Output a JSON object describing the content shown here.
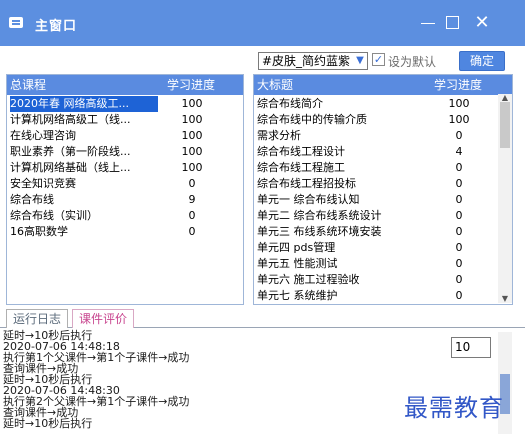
{
  "window": {
    "title": "主窗口"
  },
  "toolbar": {
    "skin_value": "#皮肤_简约蓝紫",
    "set_default_label": "设为默认",
    "set_default_checked": true,
    "confirm_label": "确定",
    "accent_color": "#5c8fe0"
  },
  "courses": {
    "header": {
      "name": "总课程",
      "progress": "学习进度"
    },
    "rows": [
      {
        "name": "2020年春 网络高级工...",
        "progress": "100",
        "selected": true
      },
      {
        "name": "计算机网络高级工（线...",
        "progress": "100"
      },
      {
        "name": "在线心理咨询",
        "progress": "100"
      },
      {
        "name": "职业素养（第一阶段线...",
        "progress": "100"
      },
      {
        "name": "计算机网络基础（线上...",
        "progress": "100"
      },
      {
        "name": "安全知识竞赛",
        "progress": "0"
      },
      {
        "name": "综合布线",
        "progress": "9"
      },
      {
        "name": "综合布线（实训）",
        "progress": "0"
      },
      {
        "name": "16高职数学",
        "progress": "0"
      }
    ]
  },
  "chapters": {
    "header": {
      "name": "大标题",
      "progress": "学习进度"
    },
    "rows": [
      {
        "name": "综合布线简介",
        "progress": "100"
      },
      {
        "name": "综合布线中的传输介质",
        "progress": "100"
      },
      {
        "name": "需求分析",
        "progress": "0"
      },
      {
        "name": "综合布线工程设计",
        "progress": "4"
      },
      {
        "name": "综合布线工程施工",
        "progress": "0"
      },
      {
        "name": "综合布线工程招投标",
        "progress": "0"
      },
      {
        "name": "单元一 综合布线认知",
        "progress": "0"
      },
      {
        "name": "单元二 综合布线系统设计",
        "progress": "0"
      },
      {
        "name": "单元三 布线系统环境安装",
        "progress": "0"
      },
      {
        "name": "单元四 pds管理",
        "progress": "0"
      },
      {
        "name": "单元五 性能测试",
        "progress": "0"
      },
      {
        "name": "单元六 施工过程验收",
        "progress": "0"
      },
      {
        "name": "单元七 系统维护",
        "progress": "0"
      }
    ]
  },
  "tabs": {
    "log": "运行日志",
    "evaluation": "课件评价"
  },
  "log": {
    "lines": [
      "延时→10秒后执行",
      "2020-07-06 14:48:18",
      "执行第1个父课件→第1个子课件→成功",
      "查询课件→成功",
      "延时→10秒后执行",
      "2020-07-06 14:48:30",
      "执行第2个父课件→第1个子课件→成功",
      "查询课件→成功",
      "延时→10秒后执行"
    ],
    "interval_value": "10"
  },
  "watermark": "最需教育"
}
